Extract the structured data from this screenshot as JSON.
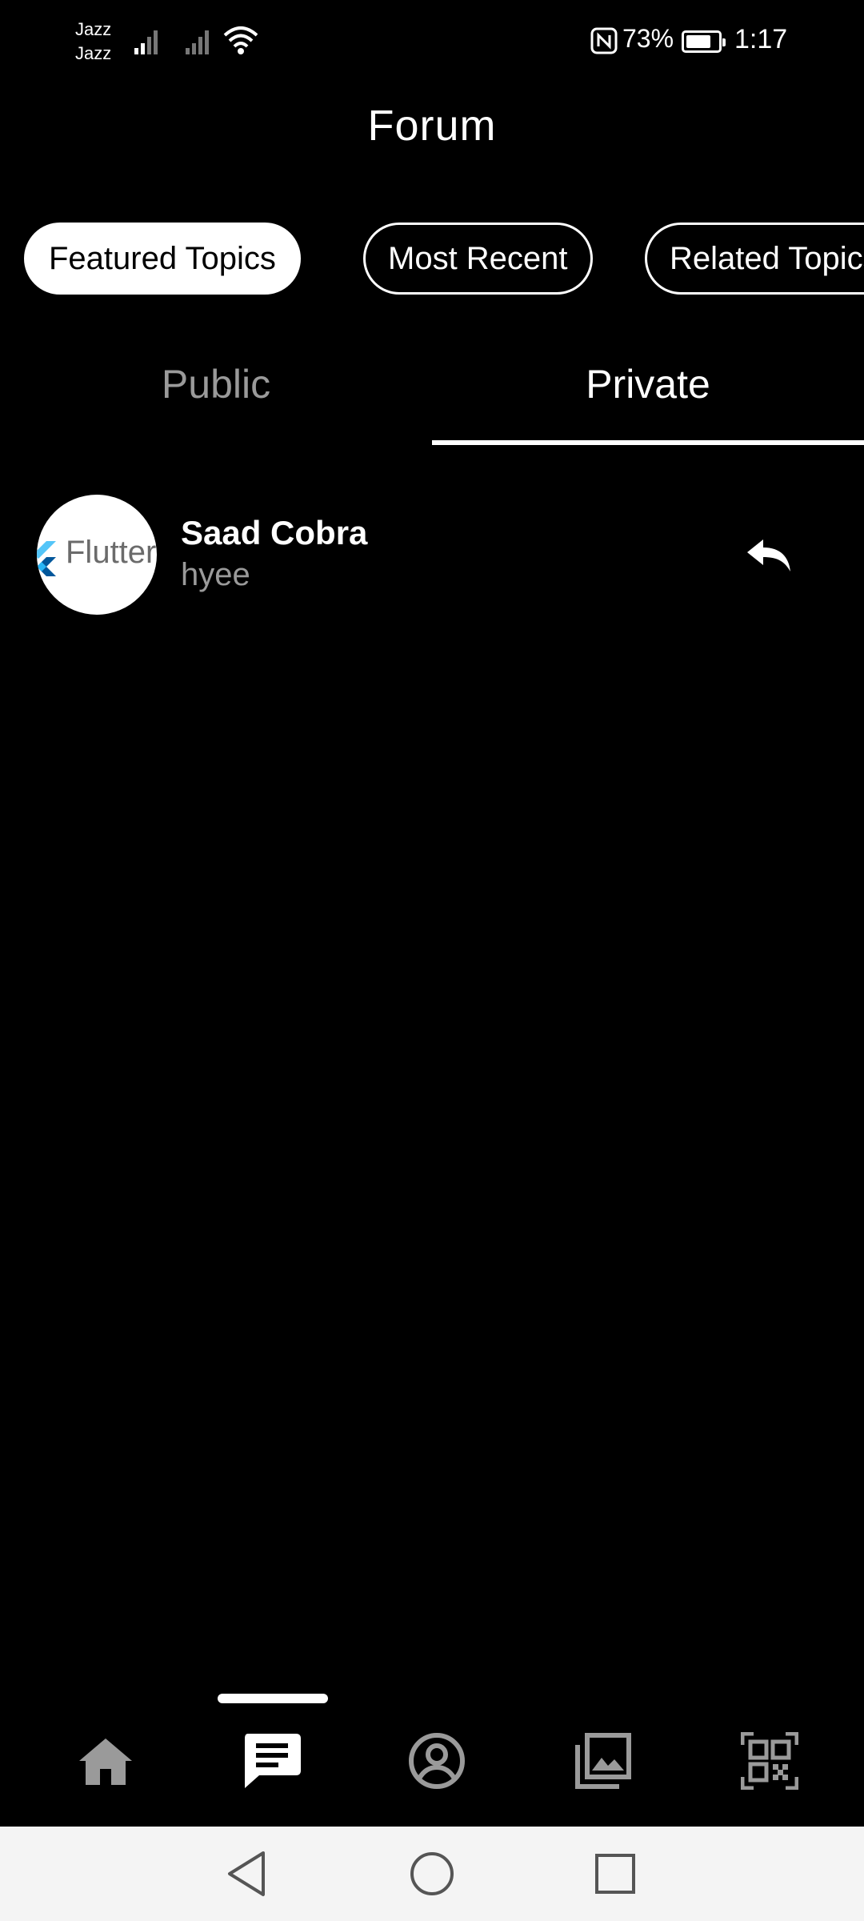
{
  "status_bar": {
    "carrier_1": "Jazz",
    "carrier_2": "Jazz",
    "battery_percent": "73%",
    "battery_level": 0.73,
    "time": "1:17"
  },
  "header": {
    "title": "Forum"
  },
  "chips": [
    {
      "label": "Featured Topics",
      "active": true
    },
    {
      "label": "Most Recent",
      "active": false
    },
    {
      "label": "Related Topics",
      "active": false
    }
  ],
  "tabs": [
    {
      "label": "Public",
      "selected": false
    },
    {
      "label": "Private",
      "selected": true
    }
  ],
  "messages": [
    {
      "avatar_text": "Flutter",
      "sender": "Saad Cobra",
      "preview": "hyee",
      "action_icon": "reply-icon"
    }
  ],
  "bottom_nav": {
    "items": [
      {
        "icon": "home-icon",
        "active": false
      },
      {
        "icon": "chat-icon",
        "active": true
      },
      {
        "icon": "profile-icon",
        "active": false
      },
      {
        "icon": "gallery-icon",
        "active": false
      },
      {
        "icon": "qr-code-icon",
        "active": false
      }
    ]
  },
  "system_nav": {
    "icons": [
      "back-icon",
      "home-circle-icon",
      "recents-icon"
    ]
  },
  "colors": {
    "background": "#000000",
    "active_chip_bg": "#ffffff",
    "inactive_text": "#9a9a9a",
    "nav_icon": "#9a9a9a"
  }
}
